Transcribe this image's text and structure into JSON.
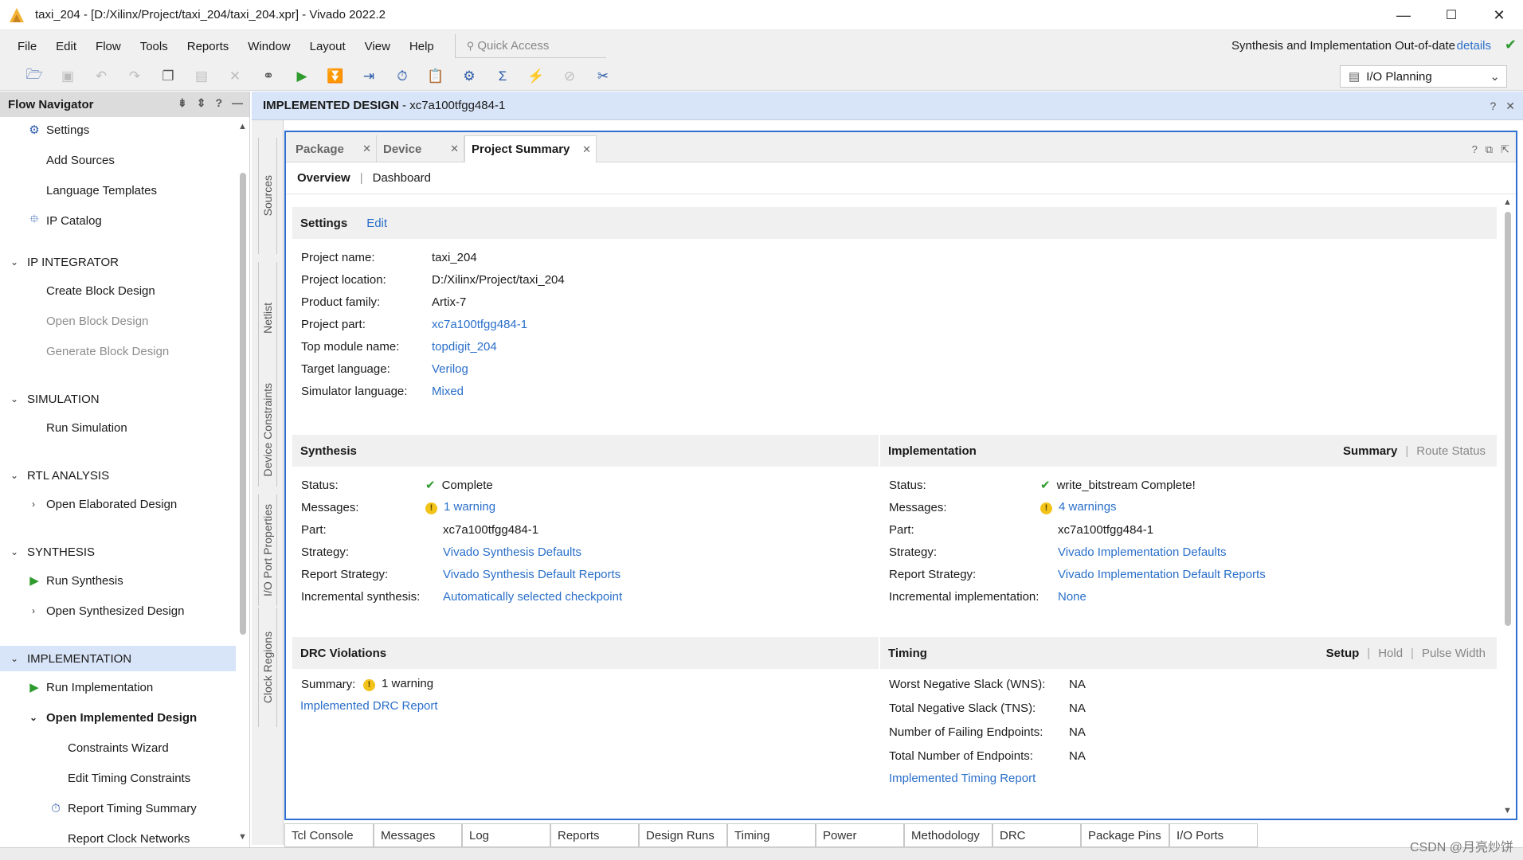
{
  "window": {
    "title": "taxi_204 - [D:/Xilinx/Project/taxi_204/taxi_204.xpr] - Vivado 2022.2",
    "minimize": "—",
    "maximize": "☐",
    "close": "✕"
  },
  "menu": {
    "items": [
      "File",
      "Edit",
      "Flow",
      "Tools",
      "Reports",
      "Window",
      "Layout",
      "View",
      "Help"
    ],
    "quick_access_placeholder": "Quick Access",
    "status_text": "Synthesis and Implementation Out-of-date",
    "details_link": "details"
  },
  "toolbar": {
    "layout_selected": "I/O Planning",
    "icons": [
      "open-project-icon",
      "save-icon",
      "undo-icon",
      "redo-icon",
      "copy-icon",
      "paste-icon",
      "delete-icon",
      "find-icon",
      "run-icon",
      "step-icon",
      "export-icon",
      "timer-icon",
      "clipboard-icon",
      "settings-icon",
      "sigma-icon",
      "disconnect-icon",
      "cancel-icon",
      "tools-icon"
    ]
  },
  "flow_navigator": {
    "title": "Flow Navigator",
    "items": [
      {
        "label": "Settings",
        "kind": "item",
        "icon": "gear-icon"
      },
      {
        "label": "Add Sources",
        "kind": "item"
      },
      {
        "label": "Language Templates",
        "kind": "item"
      },
      {
        "label": "IP Catalog",
        "kind": "item",
        "icon": "ip-catalog-icon"
      },
      {
        "label": "IP INTEGRATOR",
        "kind": "section"
      },
      {
        "label": "Create Block Design",
        "kind": "item"
      },
      {
        "label": "Open Block Design",
        "kind": "item",
        "dim": true
      },
      {
        "label": "Generate Block Design",
        "kind": "item",
        "dim": true
      },
      {
        "label": "SIMULATION",
        "kind": "section"
      },
      {
        "label": "Run Simulation",
        "kind": "item"
      },
      {
        "label": "RTL ANALYSIS",
        "kind": "section"
      },
      {
        "label": "Open Elaborated Design",
        "kind": "expandable"
      },
      {
        "label": "SYNTHESIS",
        "kind": "section"
      },
      {
        "label": "Run Synthesis",
        "kind": "item",
        "icon": "run-icon"
      },
      {
        "label": "Open Synthesized Design",
        "kind": "expandable"
      },
      {
        "label": "IMPLEMENTATION",
        "kind": "section",
        "selected": true
      },
      {
        "label": "Run Implementation",
        "kind": "item",
        "icon": "run-icon"
      },
      {
        "label": "Open Implemented Design",
        "kind": "expanded",
        "bold": true
      },
      {
        "label": "Constraints Wizard",
        "kind": "subitem"
      },
      {
        "label": "Edit Timing Constraints",
        "kind": "subitem"
      },
      {
        "label": "Report Timing Summary",
        "kind": "subitem",
        "icon": "timer-icon"
      },
      {
        "label": "Report Clock Networks",
        "kind": "subitem"
      }
    ]
  },
  "implemented_design": {
    "label": "IMPLEMENTED DESIGN",
    "part": " - xc7a100tfgg484-1"
  },
  "side_tabs": [
    "Sources",
    "Netlist",
    "Device Constraints",
    "I/O Port Properties",
    "Clock Regions"
  ],
  "doc_tabs": [
    {
      "label": "Package",
      "active": false
    },
    {
      "label": "Device",
      "active": false
    },
    {
      "label": "Project Summary",
      "active": true
    }
  ],
  "sub_tabs": {
    "overview": "Overview",
    "dashboard": "Dashboard"
  },
  "settings": {
    "title": "Settings",
    "edit_link": "Edit",
    "rows": [
      {
        "key": "Project name:",
        "value": "taxi_204",
        "link": false
      },
      {
        "key": "Project location:",
        "value": "D:/Xilinx/Project/taxi_204",
        "link": false
      },
      {
        "key": "Product family:",
        "value": "Artix-7",
        "link": false
      },
      {
        "key": "Project part:",
        "value": "xc7a100tfgg484-1",
        "link": true
      },
      {
        "key": "Top module name:",
        "value": "topdigit_204",
        "link": true
      },
      {
        "key": "Target language:",
        "value": "Verilog",
        "link": true
      },
      {
        "key": "Simulator language:",
        "value": "Mixed",
        "link": true
      }
    ]
  },
  "synthesis": {
    "title": "Synthesis",
    "rows": [
      {
        "key": "Status:",
        "value": "Complete",
        "icon": "check-icon",
        "link": false
      },
      {
        "key": "Messages:",
        "value": "1 warning",
        "icon": "warning-icon",
        "link": true
      },
      {
        "key": "Part:",
        "value": "xc7a100tfgg484-1",
        "link": false
      },
      {
        "key": "Strategy:",
        "value": "Vivado Synthesis Defaults",
        "link": true
      },
      {
        "key": "Report Strategy:",
        "value": "Vivado Synthesis Default Reports",
        "link": true
      },
      {
        "key": "Incremental synthesis:",
        "value": "Automatically selected checkpoint",
        "link": true
      }
    ]
  },
  "implementation": {
    "title": "Implementation",
    "tab_summary": "Summary",
    "tab_route": "Route Status",
    "rows": [
      {
        "key": "Status:",
        "value": "write_bitstream Complete!",
        "icon": "check-icon",
        "link": false
      },
      {
        "key": "Messages:",
        "value": "4 warnings",
        "icon": "warning-icon",
        "link": true
      },
      {
        "key": "Part:",
        "value": "xc7a100tfgg484-1",
        "link": false
      },
      {
        "key": "Strategy:",
        "value": "Vivado Implementation Defaults",
        "link": true
      },
      {
        "key": "Report Strategy:",
        "value": "Vivado Implementation Default Reports",
        "link": true
      },
      {
        "key": "Incremental implementation:",
        "value": "None",
        "link": true
      }
    ]
  },
  "drc": {
    "title": "DRC Violations",
    "summary_key": "Summary:",
    "summary_value": "1 warning",
    "report_link": "Implemented DRC Report"
  },
  "timing": {
    "title": "Timing",
    "tab_setup": "Setup",
    "tab_hold": "Hold",
    "tab_pulse": "Pulse Width",
    "rows": [
      {
        "key": "Worst Negative Slack (WNS):",
        "value": "NA"
      },
      {
        "key": "Total Negative Slack (TNS):",
        "value": "NA"
      },
      {
        "key": "Number of Failing Endpoints:",
        "value": "NA"
      },
      {
        "key": "Total Number of Endpoints:",
        "value": "NA"
      }
    ],
    "report_link": "Implemented Timing Report"
  },
  "bottom_tabs": [
    "Tcl Console",
    "Messages",
    "Log",
    "Reports",
    "Design Runs",
    "Timing",
    "Power",
    "Methodology",
    "DRC",
    "Package Pins",
    "I/O Ports"
  ],
  "watermark": "CSDN @月亮炒饼",
  "colors": {
    "accent": "#2f6fd0",
    "link": "#2a6fc9",
    "selected": "#d8e4f7",
    "ok": "#2f9b2f",
    "warn": "#f2c318"
  }
}
